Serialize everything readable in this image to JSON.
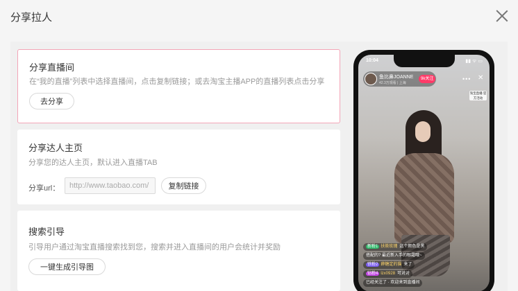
{
  "dialog": {
    "title": "分享拉人"
  },
  "cards": {
    "share_room": {
      "title": "分享直播间",
      "desc": "在“我的直播”列表中选择直播间，点击复制链接；或去淘宝主播APP的直播列表点击分享",
      "button": "去分享"
    },
    "share_profile": {
      "title": "分享达人主页",
      "desc": "分享您的达人主页，默认进入直播TAB",
      "url_label": "分享url：",
      "url_value": "http://www.taobao.com/",
      "button": "复制链接"
    },
    "search_guide": {
      "title": "搜索引导",
      "desc": "引导用户通过淘宝直播搜索找到您，搜索并进入直播间的用户会统计并奖励",
      "button": "一键生成引导图"
    }
  },
  "preview": {
    "status_time": "10:04",
    "status_icons": "▮▮ ᯤ ▭",
    "anchor_name": "鱼比鼻JOANNE",
    "anchor_views": "42.3万观看 | 上海",
    "follow": "9k关注",
    "more": "•••",
    "close": "✕",
    "badge": "淘宝直播 官方活动",
    "chat": [
      {
        "level": "新粉1",
        "user": "扶筱玫瑰",
        "text": "这个颜色是黑",
        "cls": ""
      },
      {
        "level": "",
        "user": "",
        "text": "搭配的? 最近新入手的眼霜哦~",
        "cls": ""
      },
      {
        "level": "铁粉2",
        "user": "薛糖定的猫",
        "text": "来了",
        "cls": "b"
      },
      {
        "level": "钻粉4",
        "user": "lzx0928",
        "text": "可对对",
        "cls": "p"
      },
      {
        "level": "",
        "user": "",
        "text": "已经关注了 · 欢迎来到直播间",
        "cls": ""
      }
    ]
  },
  "colors": {
    "active_border": "#f3a4b6",
    "follow_pink": "#ff3a68"
  }
}
